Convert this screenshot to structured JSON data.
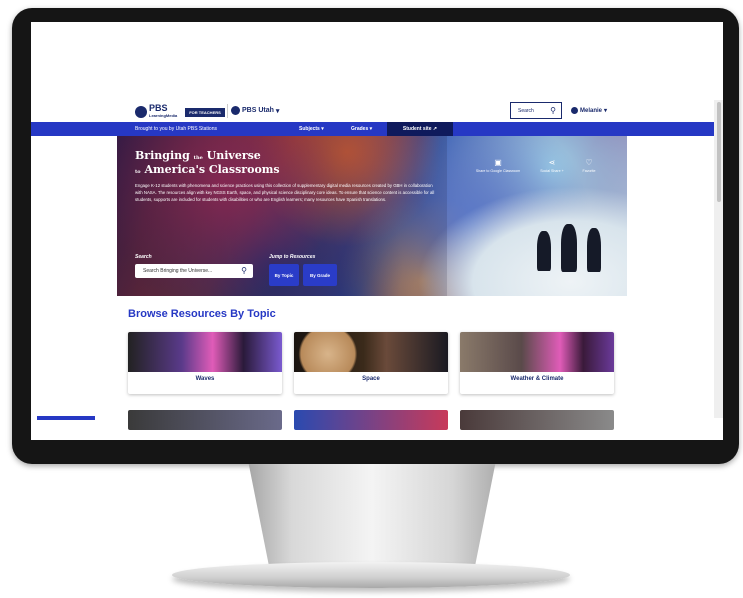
{
  "header": {
    "logo_text": "PBS",
    "logo_sub": "LearningMedia",
    "teachers_badge": "FOR TEACHERS",
    "station": "PBS Utah",
    "search_label": "Search",
    "user": "Melanie"
  },
  "nav": {
    "brought_by": "Brought to you by Utah PBS Stations",
    "subjects": "Subjects",
    "grades": "Grades",
    "student_site": "Student site"
  },
  "hero": {
    "title_line1_a": "Bringing",
    "title_line1_b": "the",
    "title_line1_c": "Universe",
    "title_line2_a": "to",
    "title_line2_b": "America's Classrooms",
    "description": "Engage K-12 students with phenomena and science practices using this collection of supplementary digital media resources created by GBH in collaboration with NASA. The resources align with key NGSS Earth, space, and physical science disciplinary core ideas. To ensure that science content is accessible for all students, supports are included for students with disabilities or who are English learners; many resources have Spanish translations.",
    "search_label": "Search",
    "search_placeholder": "Search Bringing the Universe...",
    "jump_label": "Jump to Resources",
    "by_topic": "By Topic",
    "by_grade": "By Grade",
    "actions": {
      "classroom": "Share to Google Classroom",
      "social": "Social Share +",
      "favorite": "Favorite"
    }
  },
  "browse": {
    "title": "Browse Resources By Topic",
    "cards": [
      {
        "label": "Waves"
      },
      {
        "label": "Space"
      },
      {
        "label": "Weather & Climate"
      }
    ]
  }
}
